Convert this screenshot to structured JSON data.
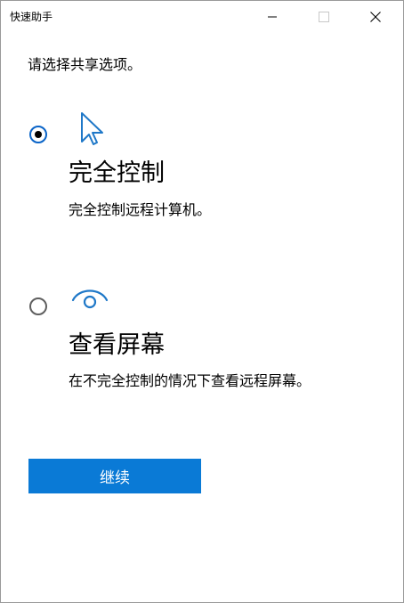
{
  "window": {
    "title": "快速助手",
    "controls": {
      "minimize_icon": "minimize-icon",
      "maximize_icon": "maximize-icon",
      "close_icon": "close-icon"
    }
  },
  "prompt": "请选择共享选项。",
  "options": [
    {
      "icon": "cursor-pointer-icon",
      "title": "完全控制",
      "description": "完全控制远程计算机。",
      "selected": true
    },
    {
      "icon": "eye-icon",
      "title": "查看屏幕",
      "description": "在不完全控制的情况下查看远程屏幕。",
      "selected": false
    }
  ],
  "continue_label": "继续",
  "colors": {
    "accent": "#0a7ad6",
    "icon_blue": "#1f78c8",
    "radio_checked_border": "#0a64c8",
    "radio_unchecked_border": "#5f5f5f"
  }
}
